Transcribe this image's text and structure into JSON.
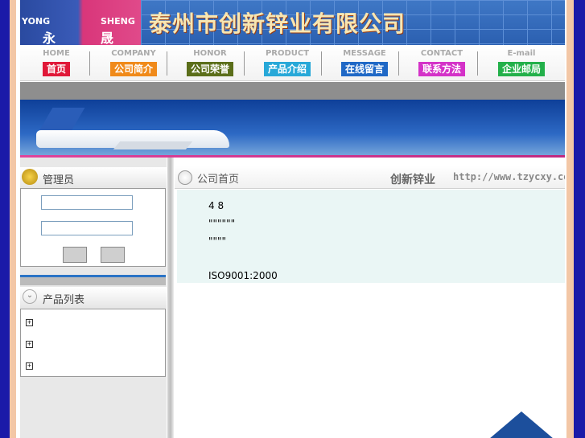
{
  "header": {
    "company_name": "泰州市创新锌业有限公司",
    "logo_left_en": "YONG",
    "logo_right_en": "SHENG",
    "logo_left_cn": "永",
    "logo_right_cn": "晟"
  },
  "nav": [
    {
      "en": "HOME",
      "cn": "首页",
      "color": "#e01838"
    },
    {
      "en": "COMPANY",
      "cn": "公司简介",
      "color": "#f08a1a"
    },
    {
      "en": "HONOR",
      "cn": "公司荣誉",
      "color": "#5b6e1a"
    },
    {
      "en": "PRODUCT",
      "cn": "产品介绍",
      "color": "#27a8d8"
    },
    {
      "en": "MESSAGE",
      "cn": "在线留言",
      "color": "#1f68c6"
    },
    {
      "en": "CONTACT",
      "cn": "联系方法",
      "color": "#d432c8"
    },
    {
      "en": "E-mail",
      "cn": "企业邮局",
      "color": "#23b04a"
    }
  ],
  "band_glyph": "",
  "sidebar": {
    "admin_title": "管理员",
    "username_label": "",
    "password_label": "",
    "login_button": "",
    "reset_button": "",
    "products_title": "产品列表",
    "products": [
      {
        "label": ""
      },
      {
        "label": ""
      },
      {
        "label": ""
      }
    ]
  },
  "main": {
    "section_title": "公司首页",
    "brand": "创新锌业",
    "url": "http://www.tzycxy.com",
    "lines": [
      "4 8",
      "\"\"\"\"\"\"",
      "\"\"\"\"",
      "",
      "ISO9001:2000",
      " "
    ]
  },
  "side_glyph_left": "",
  "side_glyph_right": ""
}
